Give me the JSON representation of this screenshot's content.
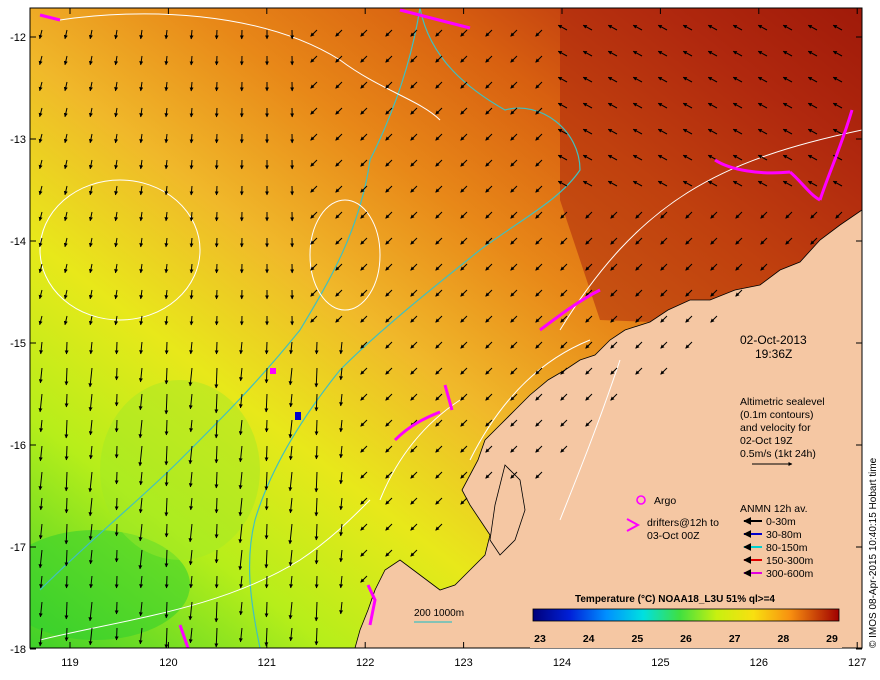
{
  "map": {
    "axes": {
      "lon_ticks": [
        "119",
        "120",
        "121",
        "122",
        "123",
        "124",
        "125",
        "126",
        "127"
      ],
      "lat_ticks": [
        "-12",
        "-13",
        "-14",
        "-15",
        "-16",
        "-17",
        "-18"
      ]
    },
    "date": "02-Oct-2013",
    "time": "19:36Z",
    "altimetry_note": [
      "Altimetric sealevel",
      "(0.1m contours)",
      "and velocity for",
      "02-Oct 19Z",
      "0.5m/s (1kt 24h)"
    ],
    "argo_label": "Argo",
    "drifters_label": [
      "drifters@12h to",
      "03-Oct 00Z"
    ],
    "anmn": {
      "title": "ANMN 12h av.",
      "entries": [
        {
          "label": "0-30m",
          "color": "#000000"
        },
        {
          "label": "30-80m",
          "color": "#0000cc"
        },
        {
          "label": "80-150m",
          "color": "#00d0d0"
        },
        {
          "label": "150-300m",
          "color": "#e00000"
        },
        {
          "label": "300-600m",
          "color": "#e000e0"
        }
      ]
    },
    "isobath_label": "200  1000m",
    "colorbar": {
      "title": "Temperature (°C) NOAA18_L3U 51% ql>=4",
      "ticks": [
        "23",
        "24",
        "25",
        "26",
        "27",
        "28",
        "29"
      ]
    },
    "credit": "© IMOS 08-Apr-2015 10:40:15 Hobart time",
    "colors": {
      "land": "#f5c7a3",
      "isobath": "#40c0c0",
      "contour": "#ffffff",
      "drifter": "#ff00ff"
    }
  }
}
